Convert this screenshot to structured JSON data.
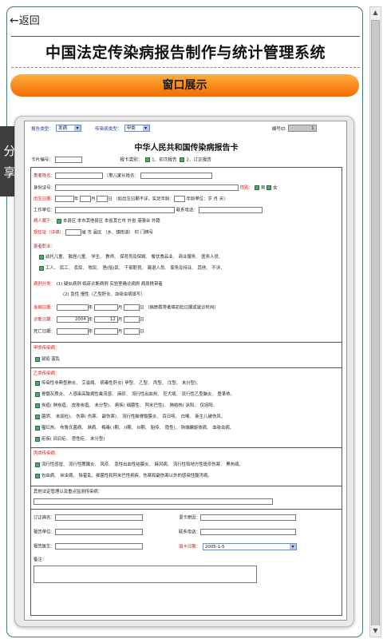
{
  "nav": {
    "back_label": "返回"
  },
  "header": {
    "title": "中国法定传染病报告制作与统计管理系统"
  },
  "banner": {
    "label": "窗口展示"
  },
  "share": {
    "label_1": "分",
    "label_2": "享"
  },
  "card": {
    "report_type_label": "报告类型：",
    "report_type_value": "发病",
    "disease_type_label": "传染病类型：",
    "disease_type_value": "甲类",
    "number_label": "编号ID",
    "number_value": "1",
    "title": "中华人民共和国传染病报告卡",
    "card_no_label": "卡片编号：",
    "report_category_label": "报卡类别：",
    "report_category_1": "1、初次报告",
    "report_category_2": "2、订正报告",
    "patient_name_label": "患者姓名：",
    "guardian_name_label": "（患儿家长姓名：",
    "id_label": "身份证号：",
    "gender_label": "性别：",
    "gender_male": "男",
    "gender_female": "女",
    "dob_label": "出生日期：",
    "year": "年",
    "month": "月",
    "day": "日",
    "dob_note": "（如出生日期不详，实足年龄：",
    "age_unit_label": "年龄单位：",
    "age_units": "岁  月  天）",
    "work_unit_label": "工作单位：",
    "phone_label": "联系电话：",
    "belong_label": "病人属于：",
    "belong_options": "本县区  本市其他县区  本省其它市  外省  港澳台  外籍",
    "address_label": "现住址（详填）：",
    "address_parts": "省       市       县区       （乡、镇街道）       村       门牌号",
    "occupation_label": "患者职业：",
    "occupation_line1": "幼托儿童、 散居儿童、 学生、 教师、 保育员及保姆、 餐饮食品业、 商业服务、 医务人员、",
    "occupation_line2": "工人、 民工、 农民、 牧民、 渔(船)民、 干部职员、 离退人员、 家务及待业、 其他、 不详、",
    "case_class_label": "病例分类：",
    "case_class_line1": "(1) 疑似病例  临床诊断病例  实验室确诊病例  病原携带者",
    "case_class_line2": "(2) 急性  慢性（乙型肝炎、血吸虫病填写）",
    "onset_label": "发病日期：",
    "onset_note": "（病原携带者填初检日期或就诊时间）",
    "diagnosis_label": "诊断日期：",
    "diagnosis_year": "2004",
    "diagnosis_month": "12",
    "death_label": "死亡日期：",
    "class_a_label": "甲类传染病：",
    "class_a_items": "鼠疫  霍乱",
    "class_b_label": "乙类传染病：",
    "class_b_line1": "传染性非典型肺炎、 艾滋病、 病毒性肝炎( 甲型、 乙型、 丙型、 戊型、 未分型)、",
    "class_b_line2": "脊髓灰质炎、 人感染高致病性禽流感、 麻疹、 流行性出血热、 狂犬病、 流行性乙型脑炎、 登革热、",
    "class_b_line3": "炭疽( 肺炭疽、 皮肤炭疽、 未分型)、 痢疾( 细菌性、 阿米巴性)、 肺结核( 涂阳、 仅培阳、",
    "class_b_line4": "菌阴、 未痰检)、 伤寒( 伤寒、 副伤寒)、 流行性脑脊髓膜炎、 百日咳、 白喉、 新生儿破伤风、",
    "class_b_line5": "猩红热、 布鲁氏菌病、 淋病、 梅毒( I期、 II期、 III期、 胎传、 隐性)、 钩端螺旋体病、 血吸虫病、",
    "class_b_line6": "疟疾( 间日疟、 恶性疟、 未分型)",
    "class_c_label": "丙类传染病：",
    "class_c_line1": "流行性感冒、 流行性腮腺炎、 风疹、 急性出血性结膜炎、 麻风病、 流行性和地方性斑疹伤寒、 黑热病、",
    "class_c_line2": "包虫病、 丝虫病、 除霍乱、细菌性和阿米巴性痢疾、伤寒和副伤寒以外的感染性腹泻病。",
    "other_label": "其他法定管理以及重点监测传染病：",
    "revised_name_label": "订正病名：",
    "reject_reason_label": "退卡原因：",
    "report_unit_label": "报告单位：",
    "contact_phone_label": "联系电话：",
    "doctor_label": "报告医生：",
    "fill_date_label": "填卡日期：",
    "fill_date_value": "2005-1-5",
    "remark_label": "备注："
  },
  "colors": {
    "accent_teal": "#3f7c72",
    "banner_orange": "#f7861a",
    "label_red": "#c21a1a",
    "label_blue": "#1b3d9c"
  }
}
